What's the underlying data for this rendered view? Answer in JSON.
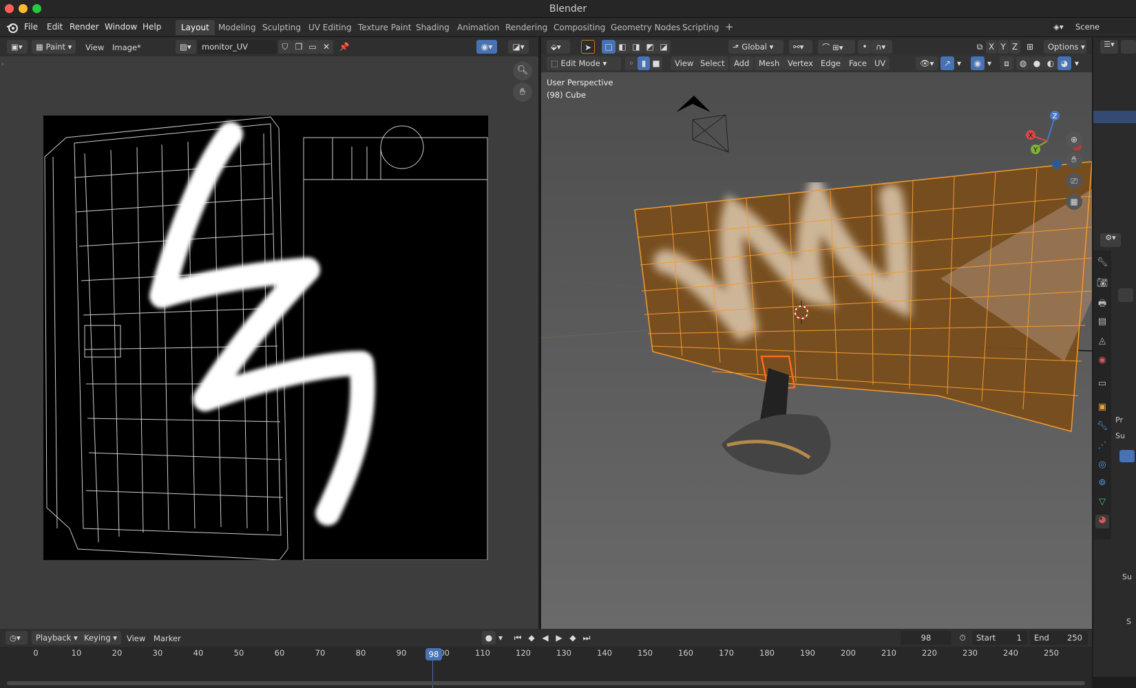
{
  "window": {
    "title": "Blender"
  },
  "menu": [
    "File",
    "Edit",
    "Render",
    "Window",
    "Help"
  ],
  "workspaces": [
    "Layout",
    "Modeling",
    "Sculpting",
    "UV Editing",
    "Texture Paint",
    "Shading",
    "Animation",
    "Rendering",
    "Compositing",
    "Geometry Nodes",
    "Scripting"
  ],
  "active_workspace": "Layout",
  "scene": {
    "label": "Scene"
  },
  "image_editor": {
    "mode": "Paint",
    "view_menu": "View",
    "image_menu": "Image*",
    "image_name": "monitor_UV"
  },
  "viewport": {
    "mode": "Edit Mode",
    "menus": [
      "View",
      "Select",
      "Add",
      "Mesh",
      "Vertex",
      "Edge",
      "Face",
      "UV"
    ],
    "transform_orientation": "Global",
    "options_label": "Options",
    "overlay_title": "User Perspective",
    "overlay_object": "(98) Cube",
    "axes": {
      "x": "X",
      "y": "Y",
      "z": "Z"
    }
  },
  "properties": {
    "panel_items": [
      "Pr",
      "Su"
    ],
    "sub_label": "Su",
    "s_label": "S"
  },
  "timeline": {
    "menus": [
      "Playback",
      "Keying",
      "View",
      "Marker"
    ],
    "current_frame": "98",
    "start_label": "Start",
    "start_value": "1",
    "end_label": "End",
    "end_value": "250",
    "ticks": [
      "0",
      "10",
      "20",
      "30",
      "40",
      "50",
      "60",
      "70",
      "80",
      "90",
      "100",
      "110",
      "120",
      "130",
      "140",
      "150",
      "160",
      "170",
      "180",
      "190",
      "200",
      "210",
      "220",
      "230",
      "240",
      "250"
    ],
    "playhead_label": "98"
  },
  "colors": {
    "accent": "#4772b3",
    "selection": "#f08a1a",
    "background": "#3d3d3d"
  }
}
